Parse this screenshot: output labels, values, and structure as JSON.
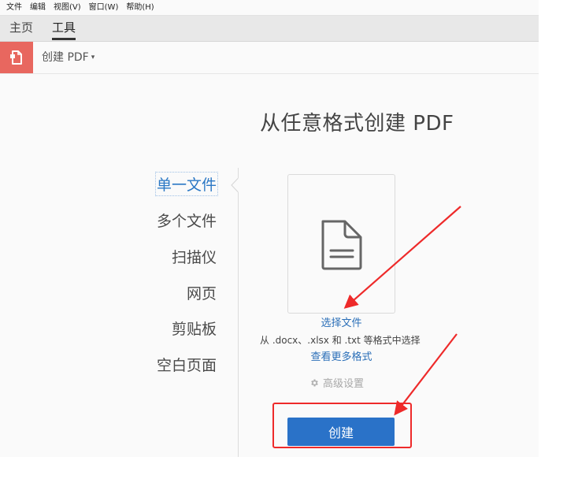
{
  "menubar": {
    "items": [
      "文件",
      "编辑",
      "视图(V)",
      "窗口(W)",
      "帮助(H)"
    ]
  },
  "tabs": {
    "home": "主页",
    "tools": "工具",
    "active": "工具"
  },
  "toolbar": {
    "tool_name": "创建 PDF",
    "caret": "▾",
    "icon": "create-pdf-icon",
    "accent_color": "#e8675f"
  },
  "main": {
    "title": "从任意格式创建 PDF",
    "nav": {
      "items": [
        "单一文件",
        "多个文件",
        "扫描仪",
        "网页",
        "剪贴板",
        "空白页面"
      ],
      "active": "单一文件"
    },
    "drop_area": {
      "icon": "document-icon",
      "select_file": "选择文件",
      "formats_hint": "从 .docx、.xlsx 和 .txt 等格式中选择",
      "more_formats": "查看更多格式"
    },
    "advanced_settings": {
      "icon": "gear-icon",
      "label": "高级设置"
    },
    "create_button": "创建"
  },
  "annotations": {
    "color": "#ee2a2a",
    "arrows": 2,
    "highlight_target": "创建"
  },
  "colors": {
    "link": "#2b6fb8",
    "primary_button": "#2a72c8",
    "active_nav": "#2b78c5"
  }
}
